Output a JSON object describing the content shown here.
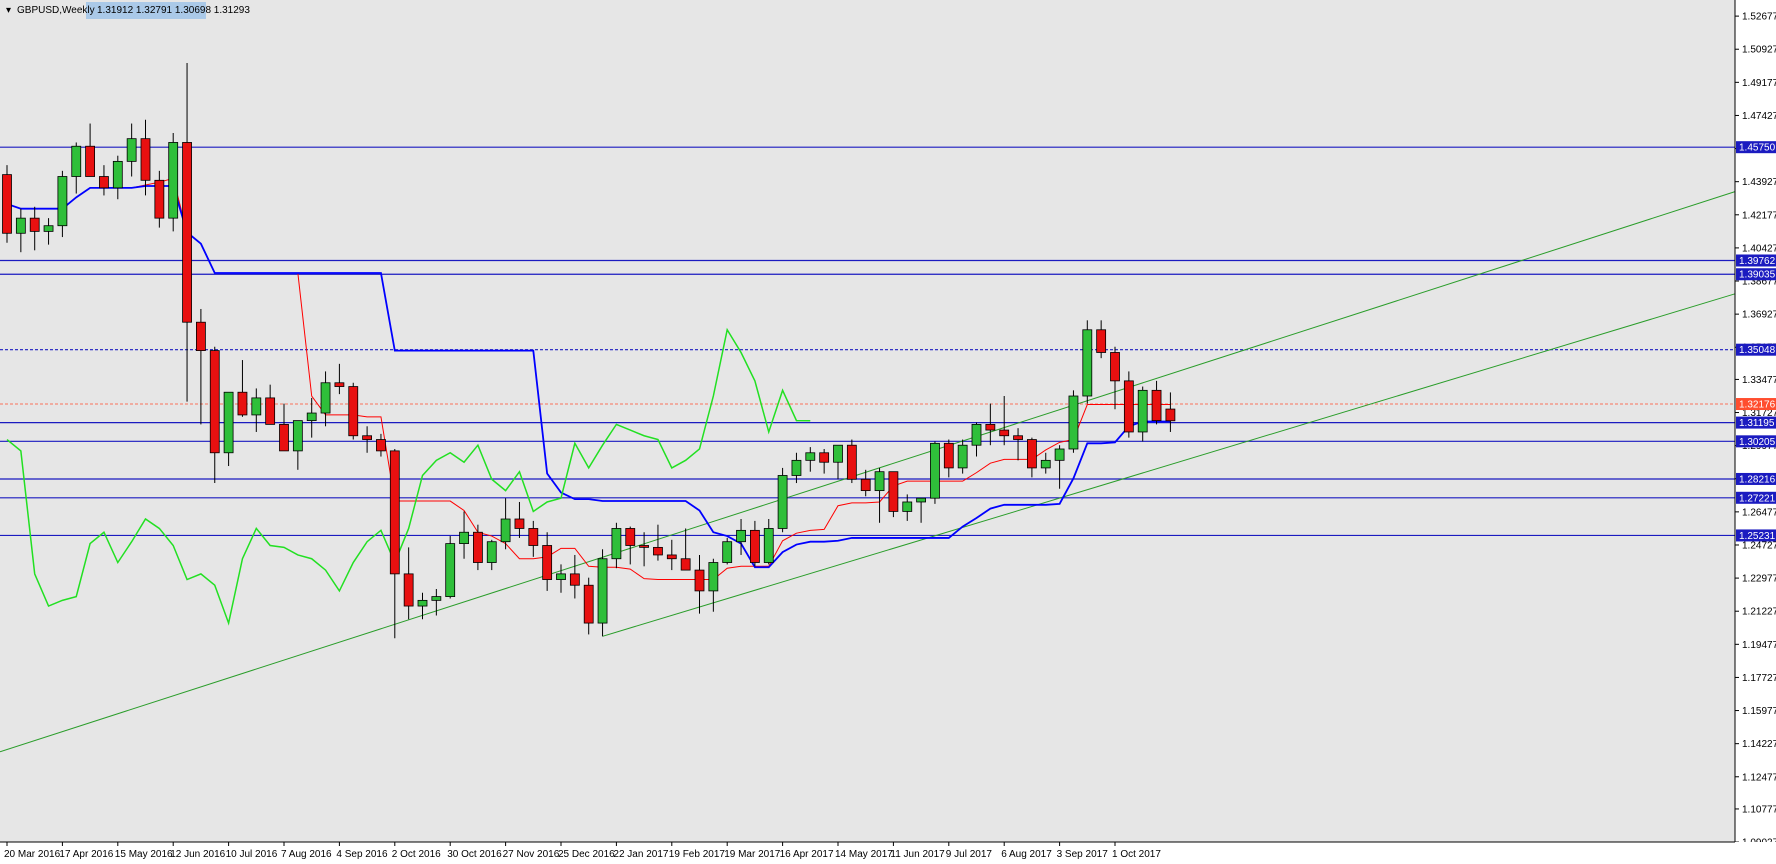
{
  "chart_data": {
    "type": "candlestick",
    "symbol": "GBPUSD,Weekly",
    "ohlc_header": "1.31912 1.32791 1.30698 1.31293",
    "ylim": [
      1.0903,
      1.53
    ],
    "y_ticks": [
      "1.52677",
      "1.50927",
      "1.49177",
      "1.47427",
      "1.45677",
      "1.43927",
      "1.42177",
      "1.40427",
      "1.38677",
      "1.36927",
      "1.35177",
      "1.33477",
      "1.31727",
      "1.29977",
      "1.28227",
      "1.26477",
      "1.24727",
      "1.22977",
      "1.21227",
      "1.19477",
      "1.17727",
      "1.15977",
      "1.14227",
      "1.12477",
      "1.10777",
      "1.09027"
    ],
    "x_labels": [
      "20 Mar 2016",
      "17 Apr 2016",
      "15 May 2016",
      "12 Jun 2016",
      "10 Jul 2016",
      "7 Aug 2016",
      "4 Sep 2016",
      "2 Oct 2016",
      "30 Oct 2016",
      "27 Nov 2016",
      "25 Dec 2016",
      "22 Jan 2017",
      "19 Feb 2017",
      "19 Mar 2017",
      "16 Apr 2017",
      "14 May 2017",
      "11 Jun 2017",
      "9 Jul 2017",
      "6 Aug 2017",
      "3 Sep 2017",
      "1 Oct 2017"
    ],
    "x_label_every": 4,
    "candles": [
      [
        1.443,
        1.448,
        1.407,
        1.412
      ],
      [
        1.412,
        1.425,
        1.402,
        1.42
      ],
      [
        1.42,
        1.426,
        1.403,
        1.413
      ],
      [
        1.413,
        1.42,
        1.406,
        1.416
      ],
      [
        1.416,
        1.445,
        1.41,
        1.442
      ],
      [
        1.442,
        1.46,
        1.433,
        1.458
      ],
      [
        1.458,
        1.47,
        1.442,
        1.442
      ],
      [
        1.442,
        1.448,
        1.432,
        1.436
      ],
      [
        1.436,
        1.453,
        1.43,
        1.45
      ],
      [
        1.45,
        1.47,
        1.442,
        1.462
      ],
      [
        1.462,
        1.472,
        1.432,
        1.44
      ],
      [
        1.44,
        1.445,
        1.415,
        1.42
      ],
      [
        1.42,
        1.465,
        1.413,
        1.46
      ],
      [
        1.46,
        1.502,
        1.323,
        1.365
      ],
      [
        1.365,
        1.372,
        1.311,
        1.35
      ],
      [
        1.35,
        1.352,
        1.28,
        1.296
      ],
      [
        1.296,
        1.328,
        1.289,
        1.328
      ],
      [
        1.328,
        1.345,
        1.315,
        1.316
      ],
      [
        1.316,
        1.33,
        1.307,
        1.325
      ],
      [
        1.325,
        1.332,
        1.311,
        1.311
      ],
      [
        1.311,
        1.322,
        1.297,
        1.297
      ],
      [
        1.297,
        1.313,
        1.287,
        1.313
      ],
      [
        1.313,
        1.325,
        1.304,
        1.317
      ],
      [
        1.317,
        1.339,
        1.31,
        1.333
      ],
      [
        1.333,
        1.343,
        1.327,
        1.331
      ],
      [
        1.331,
        1.333,
        1.303,
        1.305
      ],
      [
        1.305,
        1.31,
        1.296,
        1.303
      ],
      [
        1.303,
        1.306,
        1.294,
        1.297
      ],
      [
        1.297,
        1.298,
        1.198,
        1.232
      ],
      [
        1.232,
        1.246,
        1.208,
        1.215
      ],
      [
        1.215,
        1.222,
        1.208,
        1.218
      ],
      [
        1.218,
        1.224,
        1.21,
        1.22
      ],
      [
        1.22,
        1.252,
        1.219,
        1.248
      ],
      [
        1.248,
        1.265,
        1.24,
        1.254
      ],
      [
        1.254,
        1.258,
        1.234,
        1.238
      ],
      [
        1.238,
        1.25,
        1.234,
        1.249
      ],
      [
        1.249,
        1.272,
        1.245,
        1.261
      ],
      [
        1.261,
        1.27,
        1.251,
        1.256
      ],
      [
        1.256,
        1.26,
        1.241,
        1.247
      ],
      [
        1.247,
        1.254,
        1.223,
        1.229
      ],
      [
        1.229,
        1.237,
        1.222,
        1.232
      ],
      [
        1.232,
        1.242,
        1.219,
        1.226
      ],
      [
        1.226,
        1.23,
        1.2,
        1.206
      ],
      [
        1.206,
        1.245,
        1.199,
        1.24
      ],
      [
        1.24,
        1.259,
        1.235,
        1.256
      ],
      [
        1.256,
        1.257,
        1.237,
        1.247
      ],
      [
        1.247,
        1.254,
        1.236,
        1.246
      ],
      [
        1.246,
        1.258,
        1.239,
        1.242
      ],
      [
        1.242,
        1.25,
        1.234,
        1.24
      ],
      [
        1.24,
        1.256,
        1.234,
        1.234
      ],
      [
        1.234,
        1.242,
        1.211,
        1.223
      ],
      [
        1.223,
        1.24,
        1.212,
        1.238
      ],
      [
        1.238,
        1.251,
        1.237,
        1.249
      ],
      [
        1.249,
        1.261,
        1.242,
        1.255
      ],
      [
        1.255,
        1.26,
        1.236,
        1.238
      ],
      [
        1.238,
        1.261,
        1.237,
        1.256
      ],
      [
        1.256,
        1.288,
        1.254,
        1.284
      ],
      [
        1.284,
        1.296,
        1.28,
        1.292
      ],
      [
        1.292,
        1.299,
        1.286,
        1.296
      ],
      [
        1.296,
        1.298,
        1.285,
        1.291
      ],
      [
        1.291,
        1.3,
        1.282,
        1.3
      ],
      [
        1.3,
        1.303,
        1.28,
        1.282
      ],
      [
        1.282,
        1.287,
        1.273,
        1.276
      ],
      [
        1.276,
        1.288,
        1.259,
        1.286
      ],
      [
        1.286,
        1.286,
        1.262,
        1.265
      ],
      [
        1.265,
        1.274,
        1.26,
        1.27
      ],
      [
        1.27,
        1.272,
        1.259,
        1.272
      ],
      [
        1.272,
        1.302,
        1.269,
        1.301
      ],
      [
        1.301,
        1.303,
        1.283,
        1.288
      ],
      [
        1.288,
        1.303,
        1.285,
        1.3
      ],
      [
        1.3,
        1.312,
        1.294,
        1.311
      ],
      [
        1.311,
        1.322,
        1.3,
        1.308
      ],
      [
        1.308,
        1.326,
        1.3,
        1.305
      ],
      [
        1.305,
        1.309,
        1.292,
        1.303
      ],
      [
        1.303,
        1.304,
        1.283,
        1.288
      ],
      [
        1.288,
        1.296,
        1.285,
        1.292
      ],
      [
        1.292,
        1.3,
        1.277,
        1.298
      ],
      [
        1.298,
        1.329,
        1.296,
        1.326
      ],
      [
        1.326,
        1.366,
        1.322,
        1.361
      ],
      [
        1.361,
        1.366,
        1.346,
        1.349
      ],
      [
        1.349,
        1.352,
        1.319,
        1.334
      ],
      [
        1.334,
        1.339,
        1.304,
        1.307
      ],
      [
        1.307,
        1.331,
        1.302,
        1.329
      ],
      [
        1.329,
        1.334,
        1.311,
        1.313
      ],
      [
        1.3191,
        1.3279,
        1.307,
        1.3129
      ]
    ],
    "horizontal_levels": [
      {
        "value": 1.4575,
        "label": "1.45750",
        "style": "solid"
      },
      {
        "value": 1.39762,
        "label": "1.39762",
        "style": "solid"
      },
      {
        "value": 1.39035,
        "label": "1.39035",
        "style": "solid"
      },
      {
        "value": 1.35048,
        "label": "1.35048",
        "style": "dashed"
      },
      {
        "value": 1.31195,
        "label": "1.31195",
        "style": "solid"
      },
      {
        "value": 1.30205,
        "label": "1.30205",
        "style": "solid"
      },
      {
        "value": 1.28216,
        "label": "1.28216",
        "style": "solid"
      },
      {
        "value": 1.27221,
        "label": "1.27221",
        "style": "solid"
      },
      {
        "value": 1.25231,
        "label": "1.25231",
        "style": "solid"
      }
    ],
    "current_price": {
      "value": 1.32176,
      "label": "1.32176"
    },
    "colors": {
      "background": "#e6e6e6",
      "up": "#2fbf3a",
      "down": "#e81010",
      "level": "#1b1bc0",
      "tenkan": "#ff0000",
      "kijun": "#0000ff",
      "chikou": "#22e022",
      "channel": "#2a9d2a",
      "kumo_bear": "#f08080",
      "kumo_bull_top": "#ee8fb6",
      "kumo_bull": "#8fdcd0",
      "zone": "#fff8dc",
      "price_tag": "#ff4d2e",
      "level_tag": "#1b1bc0"
    }
  }
}
